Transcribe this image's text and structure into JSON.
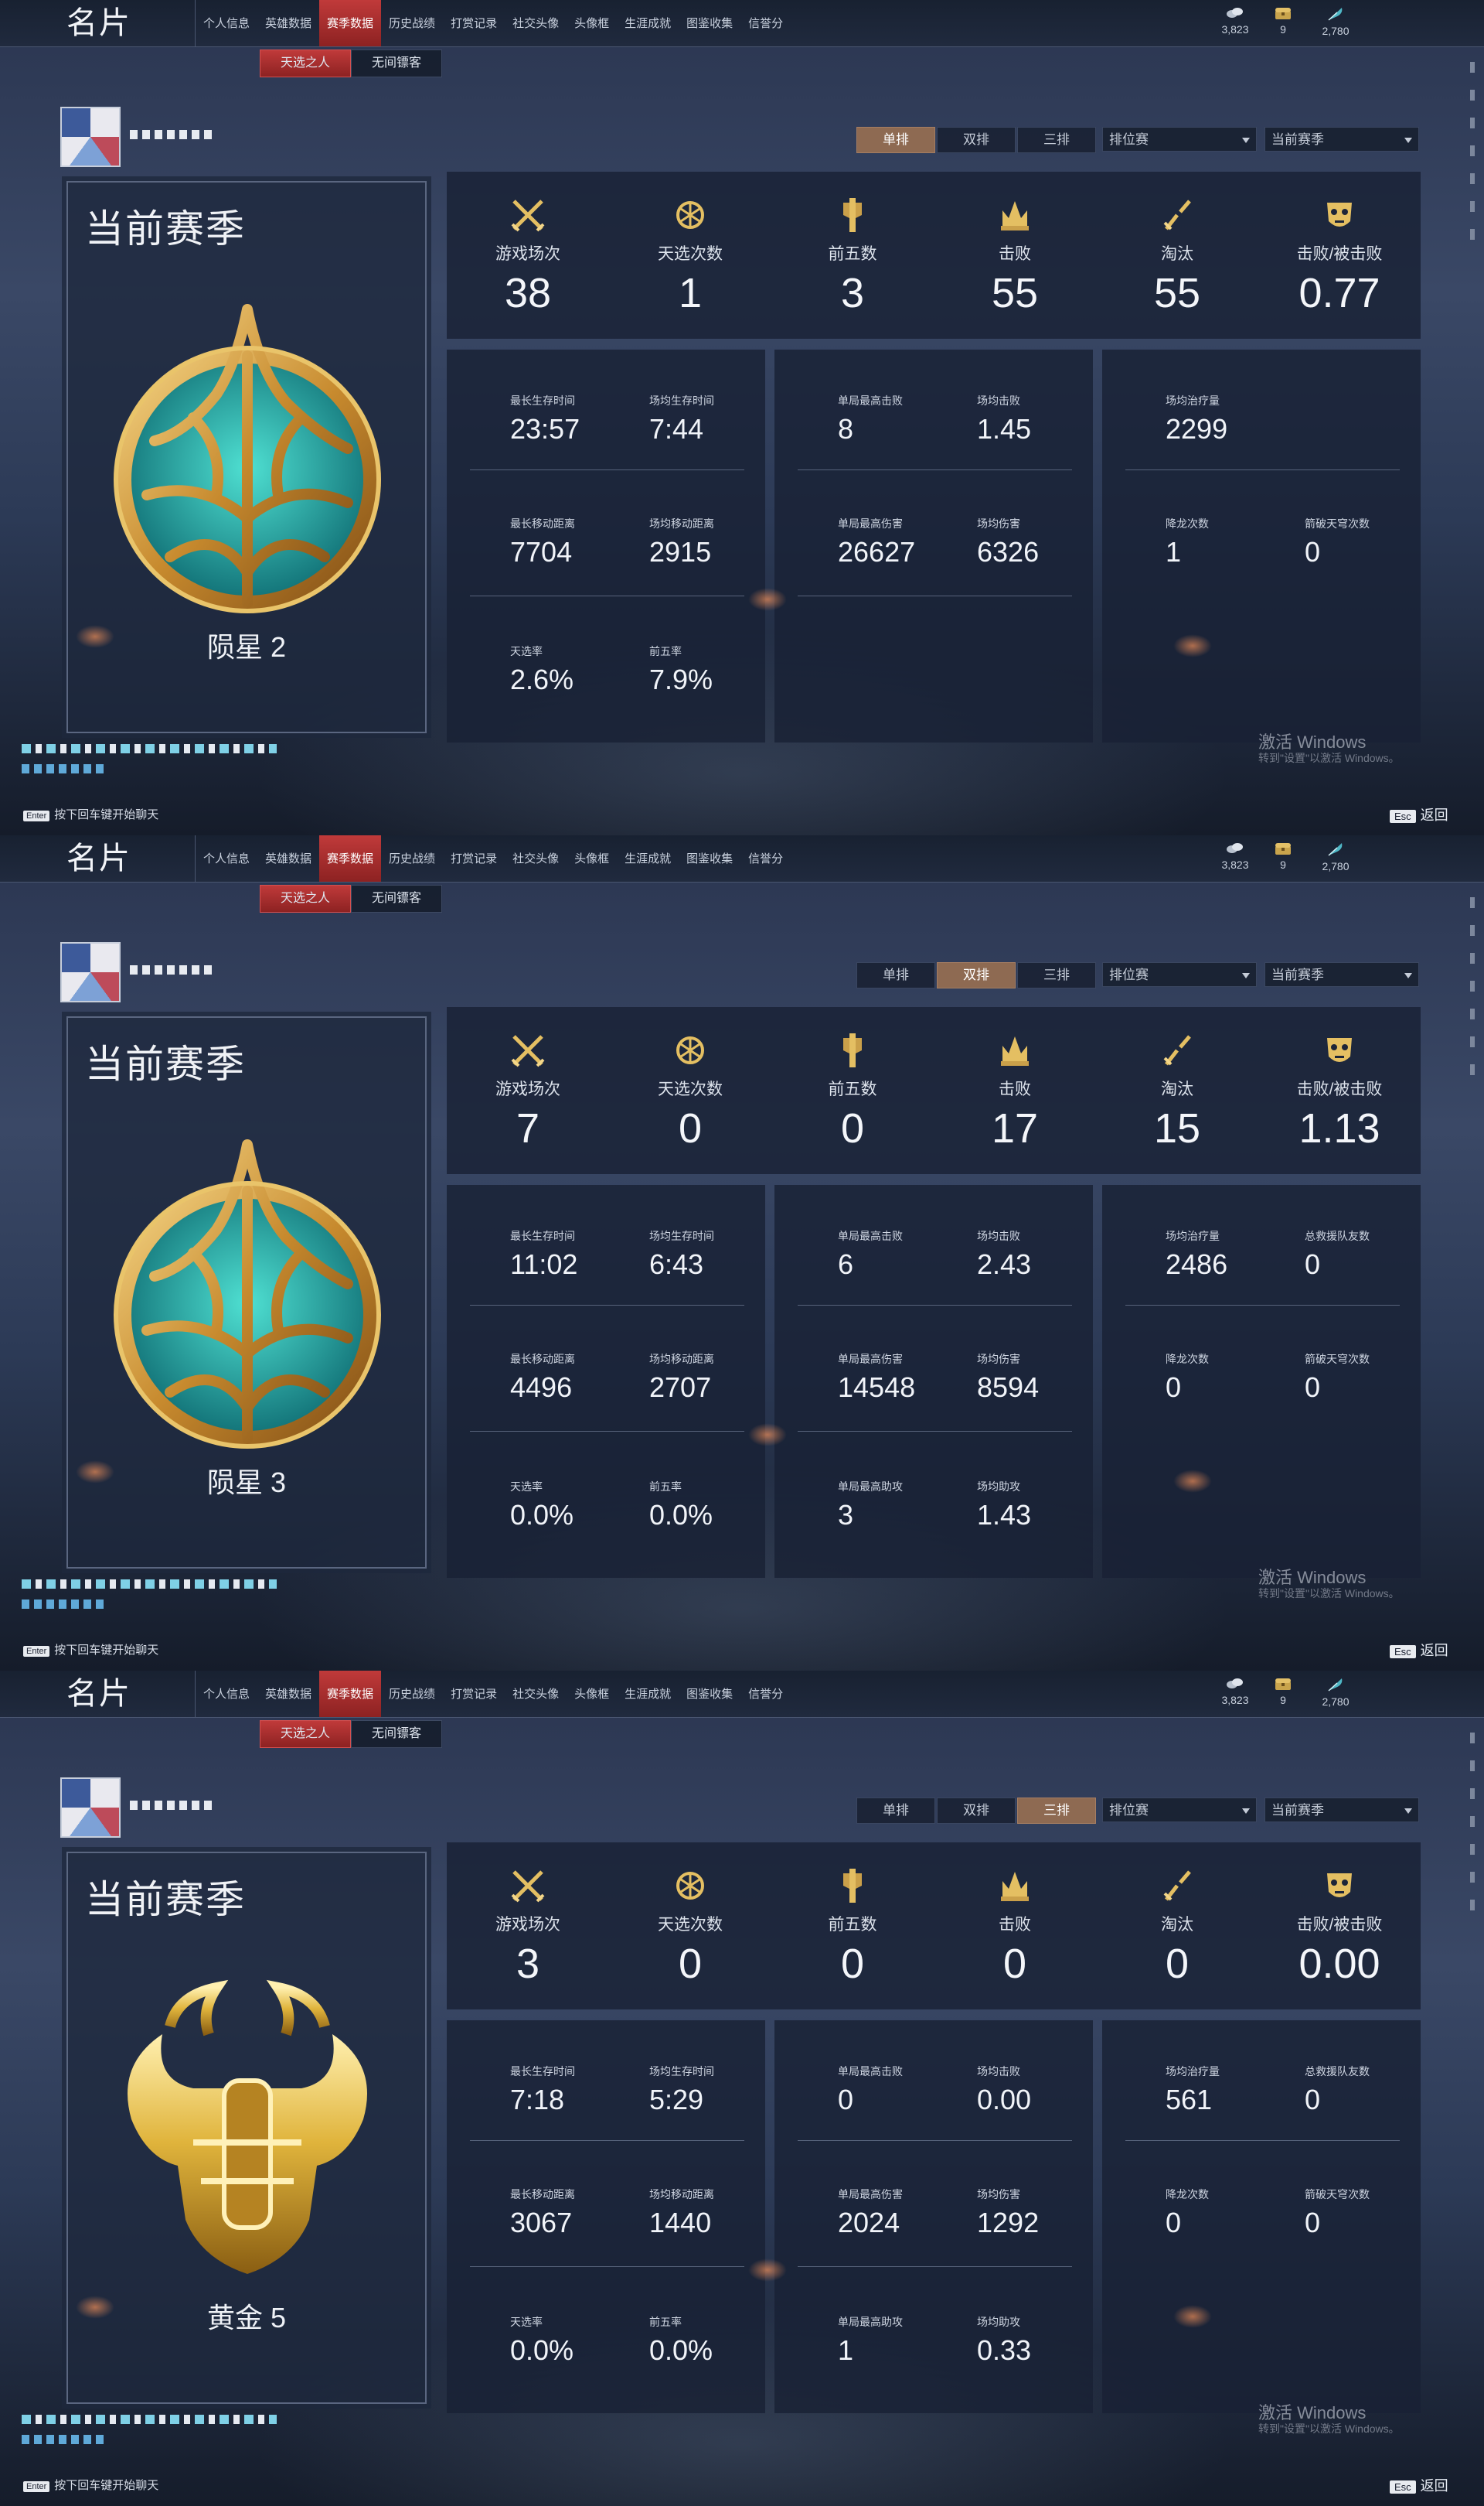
{
  "app_title": "名片",
  "nav": [
    "个人信息",
    "英雄数据",
    "赛季数据",
    "历史战绩",
    "打赏记录",
    "社交头像",
    "头像框",
    "生涯成就",
    "图鉴收集",
    "信誉分"
  ],
  "nav_active_index": 2,
  "currency": [
    "3,823",
    "9",
    "2,780"
  ],
  "subtabs": [
    "天选之人",
    "无间镖客"
  ],
  "mode_tabs": [
    "单排",
    "双排",
    "三排"
  ],
  "dropdowns": [
    "排位赛",
    "当前赛季"
  ],
  "season_title": "当前赛季",
  "top_labels": [
    "游戏场次",
    "天选次数",
    "前五数",
    "击败",
    "淘汰",
    "击败/被击败"
  ],
  "enter_hint": "按下回车键开始聊天",
  "enter_key": "Enter",
  "esc_key": "Esc",
  "esc_label": "返回",
  "watermark": [
    "激活 Windows",
    "转到\"设置\"以激活 Windows。"
  ],
  "screens": [
    {
      "active_mode": 0,
      "rank": "陨星 2",
      "emblem": "meteor-emblem",
      "top_values": [
        "38",
        "1",
        "3",
        "55",
        "55",
        "0.77"
      ],
      "panel1": [
        {
          "label": "最长生存时间",
          "value": "23:57"
        },
        {
          "label": "场均生存时间",
          "value": "7:44"
        },
        {
          "label": "最长移动距离",
          "value": "7704"
        },
        {
          "label": "场均移动距离",
          "value": "2915"
        },
        {
          "label": "天选率",
          "value": "2.6%"
        },
        {
          "label": "前五率",
          "value": "7.9%"
        }
      ],
      "panel2": [
        {
          "label": "单局最高击败",
          "value": "8"
        },
        {
          "label": "场均击败",
          "value": "1.45"
        },
        {
          "label": "单局最高伤害",
          "value": "26627"
        },
        {
          "label": "场均伤害",
          "value": "6326"
        }
      ],
      "panel3": [
        {
          "label": "场均治疗量",
          "value": "2299"
        },
        {
          "label": "降龙次数",
          "value": "1"
        },
        {
          "label": "箭破天穹次数",
          "value": "0"
        }
      ]
    },
    {
      "active_mode": 1,
      "rank": "陨星 3",
      "emblem": "meteor-emblem",
      "top_values": [
        "7",
        "0",
        "0",
        "17",
        "15",
        "1.13"
      ],
      "panel1": [
        {
          "label": "最长生存时间",
          "value": "11:02"
        },
        {
          "label": "场均生存时间",
          "value": "6:43"
        },
        {
          "label": "最长移动距离",
          "value": "4496"
        },
        {
          "label": "场均移动距离",
          "value": "2707"
        },
        {
          "label": "天选率",
          "value": "0.0%"
        },
        {
          "label": "前五率",
          "value": "0.0%"
        }
      ],
      "panel2": [
        {
          "label": "单局最高击败",
          "value": "6"
        },
        {
          "label": "场均击败",
          "value": "2.43"
        },
        {
          "label": "单局最高伤害",
          "value": "14548"
        },
        {
          "label": "场均伤害",
          "value": "8594"
        },
        {
          "label": "单局最高助攻",
          "value": "3"
        },
        {
          "label": "场均助攻",
          "value": "1.43"
        }
      ],
      "panel3": [
        {
          "label": "场均治疗量",
          "value": "2486"
        },
        {
          "label": "总救援队友数",
          "value": "0"
        },
        {
          "label": "降龙次数",
          "value": "0"
        },
        {
          "label": "箭破天穹次数",
          "value": "0"
        }
      ]
    },
    {
      "active_mode": 2,
      "rank": "黄金 5",
      "emblem": "gold-emblem",
      "top_values": [
        "3",
        "0",
        "0",
        "0",
        "0",
        "0.00"
      ],
      "panel1": [
        {
          "label": "最长生存时间",
          "value": "7:18"
        },
        {
          "label": "场均生存时间",
          "value": "5:29"
        },
        {
          "label": "最长移动距离",
          "value": "3067"
        },
        {
          "label": "场均移动距离",
          "value": "1440"
        },
        {
          "label": "天选率",
          "value": "0.0%"
        },
        {
          "label": "前五率",
          "value": "0.0%"
        }
      ],
      "panel2": [
        {
          "label": "单局最高击败",
          "value": "0"
        },
        {
          "label": "场均击败",
          "value": "0.00"
        },
        {
          "label": "单局最高伤害",
          "value": "2024"
        },
        {
          "label": "场均伤害",
          "value": "1292"
        },
        {
          "label": "单局最高助攻",
          "value": "1"
        },
        {
          "label": "场均助攻",
          "value": "0.33"
        }
      ],
      "panel3": [
        {
          "label": "场均治疗量",
          "value": "561"
        },
        {
          "label": "总救援队友数",
          "value": "0"
        },
        {
          "label": "降龙次数",
          "value": "0"
        },
        {
          "label": "箭破天穹次数",
          "value": "0"
        }
      ]
    }
  ]
}
